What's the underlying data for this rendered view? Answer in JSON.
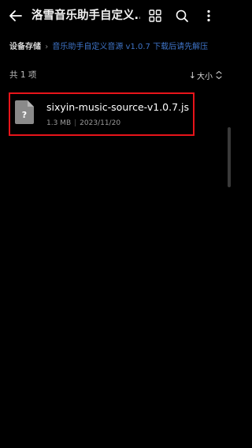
{
  "header": {
    "title": "洛雪音乐助手自定义...",
    "back_icon": "arrow-left-icon",
    "view_icon": "grid-view-icon",
    "search_icon": "search-icon",
    "more_icon": "more-vertical-icon"
  },
  "breadcrumb": {
    "root": "设备存储",
    "current": "音乐助手自定义音源 v1.0.7 下载后请先解压"
  },
  "list": {
    "count_label": "共 1 项",
    "sort_label": "大小",
    "sort_direction": "descending"
  },
  "files": [
    {
      "name": "sixyin-music-source-v1.0.7.js",
      "size": "1.3 MB",
      "date": "2023/11/20",
      "icon": "unknown-file-icon"
    }
  ],
  "colors": {
    "background": "#000000",
    "highlight_border": "#e8141a",
    "breadcrumb_link": "#3f74c7"
  }
}
